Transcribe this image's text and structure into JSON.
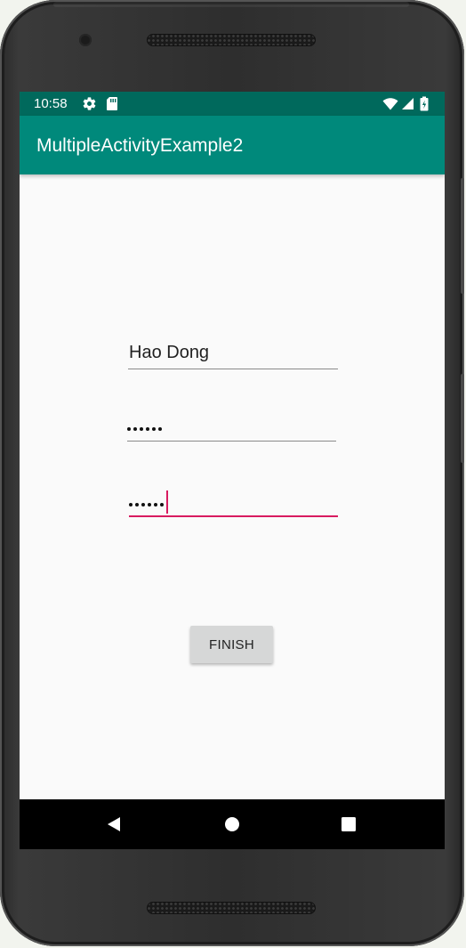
{
  "device": {
    "frame_color": "#2e2e2e"
  },
  "status_bar": {
    "time": "10:58",
    "background": "#00695c",
    "icons": [
      "settings-gear-icon",
      "sd-card-icon",
      "wifi-icon",
      "cellular-signal-icon",
      "battery-icon"
    ]
  },
  "app_bar": {
    "title": "MultipleActivityExample2",
    "background": "#00897b"
  },
  "form": {
    "name_field": {
      "value": "Hao Dong"
    },
    "password_field": {
      "masked_length": 6
    },
    "confirm_password_field": {
      "masked_length": 6,
      "focused": true
    },
    "accent_color": "#d81b60"
  },
  "finish_button": {
    "label": "FINISH"
  },
  "nav_bar": {
    "items": [
      "back-icon",
      "home-icon",
      "recents-icon"
    ]
  }
}
